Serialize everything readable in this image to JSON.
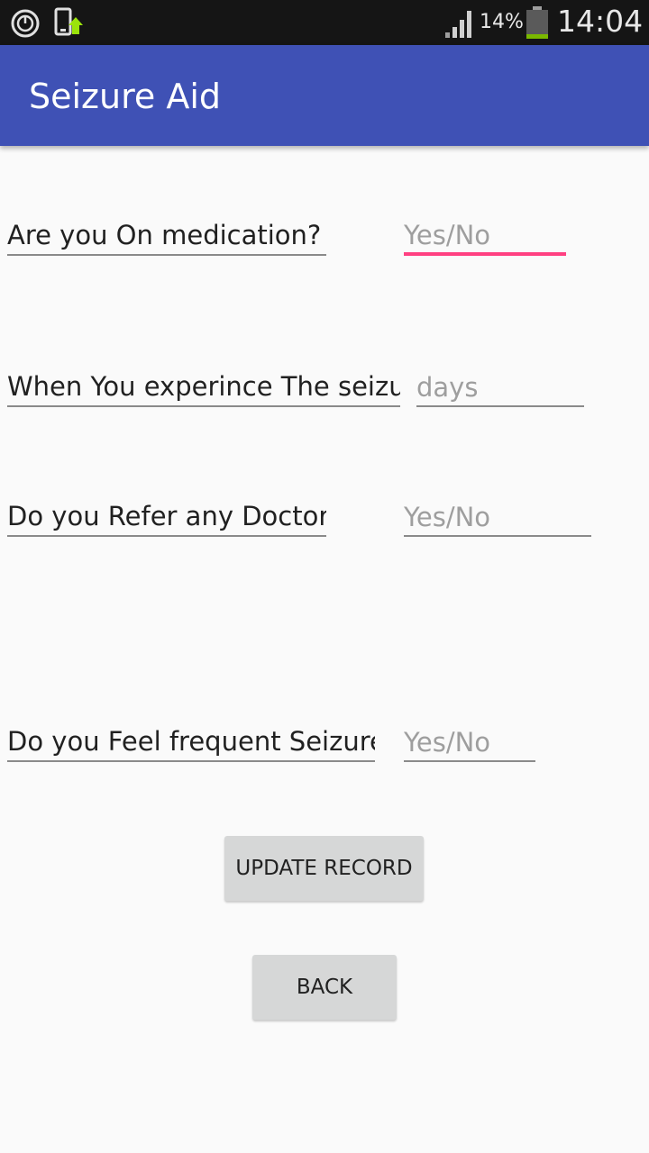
{
  "status_bar": {
    "battery_percent": "14%",
    "time": "14:04",
    "icons": [
      "sync-icon",
      "phone-update-icon",
      "signal-icon",
      "battery-icon"
    ]
  },
  "app_bar": {
    "title": "Seizure Aid"
  },
  "form": {
    "medication": {
      "label": "Are you On medication?",
      "placeholder": "Yes/No",
      "value": ""
    },
    "experience": {
      "label": "When You experince The seizure",
      "placeholder": "days",
      "value": ""
    },
    "doctor": {
      "label": "Do you Refer any Doctor?",
      "placeholder": "Yes/No",
      "value": ""
    },
    "frequent": {
      "label": "Do you Feel frequent Seizures",
      "placeholder": "Yes/No",
      "value": ""
    }
  },
  "buttons": {
    "update_label": "UPDATE RECORD",
    "back_label": "BACK"
  },
  "colors": {
    "app_bar": "#3f51b5",
    "accent": "#ff4081",
    "status_bar": "#151515",
    "button": "#d6d7d7"
  }
}
